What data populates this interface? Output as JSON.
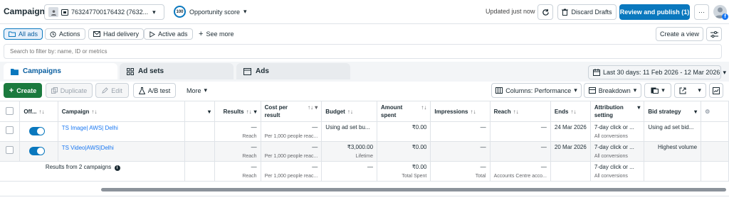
{
  "header": {
    "title": "Campaigns",
    "account_label": "763247700176432 (7632...",
    "score_value": "100",
    "score_label": "Opportunity score",
    "updated_text": "Updated just now",
    "discard_label": "Discard Drafts",
    "review_label": "Review and publish (1)",
    "more_label": "···"
  },
  "filters": {
    "all_ads": "All ads",
    "actions": "Actions",
    "had_delivery": "Had delivery",
    "active_ads": "Active ads",
    "see_more": "See more",
    "create_view": "Create a view"
  },
  "search": {
    "placeholder": "Search to filter by: name, ID or metrics"
  },
  "tabs": {
    "campaigns": "Campaigns",
    "ad_sets": "Ad sets",
    "ads": "Ads"
  },
  "date_range": "Last 30 days: 11 Feb 2026 - 12 Mar 2026",
  "toolbar": {
    "create": "Create",
    "duplicate": "Duplicate",
    "edit": "Edit",
    "ab_test": "A/B test",
    "more": "More",
    "columns": "Columns: Performance",
    "breakdown": "Breakdown"
  },
  "table": {
    "headers": {
      "off_on": "Off...",
      "campaign": "Campaign",
      "results": "Results",
      "cost_per_result_1": "Cost per",
      "cost_per_result_2": "result",
      "budget": "Budget",
      "amount_spent_1": "Amount",
      "amount_spent_2": "spent",
      "impressions": "Impressions",
      "reach": "Reach",
      "ends": "Ends",
      "attribution_1": "Attribution",
      "attribution_2": "setting",
      "bid_strategy": "Bid strategy"
    },
    "rows": [
      {
        "name": "TS Image| AWS| Delhi",
        "results": "—",
        "results_sub": "Reach",
        "cpr": "—",
        "cpr_sub": "Per 1,000 people reac...",
        "budget": "Using ad set bu...",
        "budget_sub": "",
        "spent": "₹0.00",
        "impressions": "—",
        "reach": "—",
        "ends": "24 Mar 2026",
        "attribution": "7-day click or ...",
        "attribution_sub": "All conversions",
        "bid": "Using ad set bid..."
      },
      {
        "name": "TS Video|AWS|Delhi",
        "results": "—",
        "results_sub": "Reach",
        "cpr": "—",
        "cpr_sub": "Per 1,000 people reac...",
        "budget": "₹3,000.00",
        "budget_sub": "Lifetime",
        "spent": "₹0.00",
        "impressions": "—",
        "reach": "—",
        "ends": "20 Mar 2026",
        "attribution": "7-day click or ...",
        "attribution_sub": "All conversions",
        "bid": "Highest volume"
      }
    ],
    "summary": {
      "label": "Results from 2 campaigns",
      "results": "—",
      "results_sub": "Reach",
      "cpr": "—",
      "cpr_sub": "Per 1,000 people reac...",
      "budget": "—",
      "spent": "₹0.00",
      "spent_sub": "Total Spent",
      "impressions": "—",
      "impressions_sub": "Total",
      "reach": "—",
      "reach_sub": "Accounts Centre acco...",
      "attribution": "7-day click or ...",
      "attribution_sub": "All conversions"
    }
  },
  "colors": {
    "accent": "#0a78be",
    "create_green": "#1b7a3e",
    "link": "#1877f2"
  }
}
